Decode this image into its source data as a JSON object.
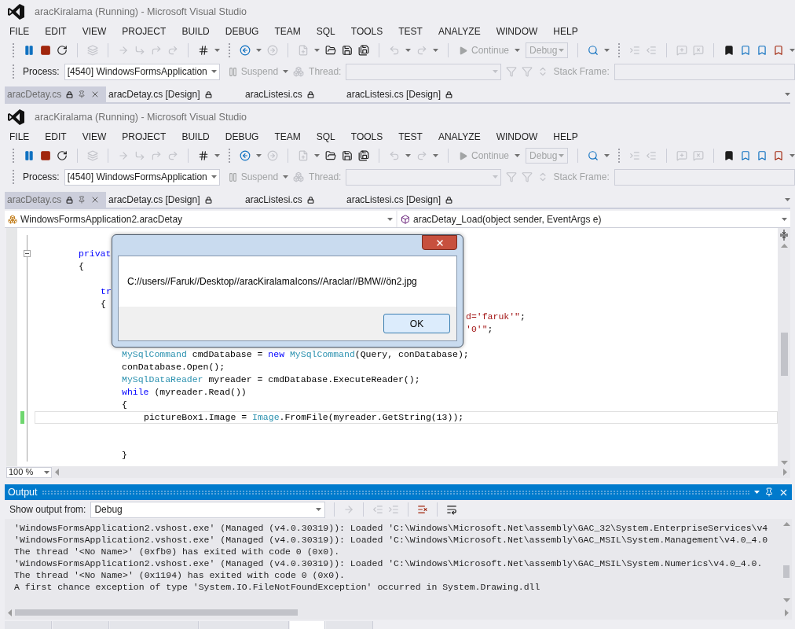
{
  "headers": [
    {
      "title": "aracKiralama (Running) - Microsoft Visual Studio",
      "menu": [
        "FILE",
        "EDIT",
        "VIEW",
        "PROJECT",
        "BUILD",
        "DEBUG",
        "TEAM",
        "SQL",
        "TOOLS",
        "TEST",
        "ANALYZE",
        "WINDOW",
        "HELP"
      ],
      "continue_button": {
        "label": "Continue",
        "disabled": true
      },
      "configuration": {
        "value": "Debug",
        "disabled": true
      },
      "process_label": "Process:",
      "process_value": "[4540] WindowsFormsApplication",
      "suspend_button": {
        "label": "Suspend",
        "disabled": true
      },
      "thread_label": {
        "label": "Thread:",
        "disabled": true
      },
      "stack_frame_label": {
        "label": "Stack Frame:",
        "disabled": true
      },
      "tabs": [
        {
          "label": "aracDetay.cs",
          "selected": true
        },
        {
          "label": "aracDetay.cs [Design]",
          "selected": false
        },
        {
          "label": "aracListesi.cs",
          "selected": false
        },
        {
          "label": "aracListesi.cs [Design]",
          "selected": false
        }
      ]
    },
    {
      "title": "aracKiralama (Running) - Microsoft Visual Studio",
      "menu": [
        "FILE",
        "EDIT",
        "VIEW",
        "PROJECT",
        "BUILD",
        "DEBUG",
        "TEAM",
        "SQL",
        "TOOLS",
        "TEST",
        "ANALYZE",
        "WINDOW",
        "HELP"
      ],
      "continue_button": {
        "label": "Continue",
        "disabled": true
      },
      "configuration": {
        "value": "Debug",
        "disabled": true
      },
      "process_label": "Process:",
      "process_value": "[4540] WindowsFormsApplication",
      "suspend_button": {
        "label": "Suspend",
        "disabled": true
      },
      "thread_label": {
        "label": "Thread:",
        "disabled": true
      },
      "stack_frame_label": {
        "label": "Stack Frame:",
        "disabled": true
      },
      "tabs": [
        {
          "label": "aracDetay.cs",
          "selected": true
        },
        {
          "label": "aracDetay.cs [Design]",
          "selected": false
        },
        {
          "label": "aracListesi.cs",
          "selected": false
        },
        {
          "label": "aracListesi.cs [Design]",
          "selected": false
        }
      ]
    }
  ],
  "navigation_bar": {
    "type_combo": "WindowsFormsApplication2.aracDetay",
    "member_combo": "aracDetay_Load(object sender, EventArgs e)"
  },
  "code_lines": [
    {
      "kind": "blank",
      "current": false
    },
    {
      "kind": "declaration",
      "current": false,
      "tokens": [
        {
          "kind": "keyword",
          "text": "privat"
        }
      ]
    },
    {
      "kind": "member",
      "current": false,
      "tokens": [
        {
          "kind": "plain",
          "text": "{"
        }
      ]
    },
    {
      "kind": "blank",
      "current": false
    },
    {
      "kind": "statement",
      "current": false,
      "tokens": [
        {
          "kind": "keyword",
          "text": "tr"
        }
      ]
    },
    {
      "kind": "statement",
      "current": false,
      "tokens": [
        {
          "kind": "plain",
          "text": "{"
        }
      ]
    },
    {
      "kind": "tail",
      "current": false,
      "tokens": [
        {
          "kind": "string",
          "text": "d='faruk'\""
        },
        {
          "kind": "plain",
          "text": ";"
        }
      ]
    },
    {
      "kind": "tail",
      "current": false,
      "tokens": [
        {
          "kind": "string",
          "text": "'0'\""
        },
        {
          "kind": "plain",
          "text": ";"
        }
      ]
    },
    {
      "kind": "blank",
      "current": false
    },
    {
      "kind": "try_statement",
      "current": false,
      "tokens": [
        {
          "kind": "type",
          "text": "MySqlCommand"
        },
        {
          "kind": "plain",
          "text": " cmdDatabase = "
        },
        {
          "kind": "keyword",
          "text": "new "
        },
        {
          "kind": "type",
          "text": "MySqlCommand"
        },
        {
          "kind": "plain",
          "text": "(Query, conDatabase);"
        }
      ]
    },
    {
      "kind": "try_statement",
      "current": false,
      "tokens": [
        {
          "kind": "plain",
          "text": "conDatabase.Open();"
        }
      ]
    },
    {
      "kind": "try_statement",
      "current": false,
      "tokens": [
        {
          "kind": "type",
          "text": "MySqlDataReader"
        },
        {
          "kind": "plain",
          "text": " myreader = cmdDatabase.ExecuteReader();"
        }
      ]
    },
    {
      "kind": "try_statement",
      "current": false,
      "tokens": [
        {
          "kind": "keyword",
          "text": "while"
        },
        {
          "kind": "plain",
          "text": " (myreader.Read())"
        }
      ]
    },
    {
      "kind": "try_statement",
      "current": false,
      "tokens": [
        {
          "kind": "plain",
          "text": "{"
        }
      ]
    },
    {
      "kind": "loop_statement",
      "current": true,
      "tokens": [
        {
          "kind": "plain",
          "text": "pictureBox1.Image = "
        },
        {
          "kind": "type",
          "text": "Image"
        },
        {
          "kind": "plain",
          "text": ".FromFile(myreader.GetString(13));"
        }
      ]
    },
    {
      "kind": "blank",
      "current": false
    },
    {
      "kind": "blank",
      "current": false
    },
    {
      "kind": "try_statement",
      "current": false,
      "tokens": [
        {
          "kind": "plain",
          "text": "}"
        }
      ]
    }
  ],
  "tool_window_tabs": [
    {
      "selected": false
    },
    {
      "selected": false
    },
    {
      "selected": false
    },
    {
      "selected": false
    },
    {
      "selected": true
    },
    {
      "selected": false
    }
  ],
  "zoom": "100 %",
  "message_box": {
    "message": "C://users//Faruk//Desktop//aracKiralamaIcons//Araclar//BMW//ön2.jpg",
    "button": "OK"
  },
  "output": {
    "title": "Output",
    "show_from_label": "Show output from:",
    "source": "Debug",
    "lines": [
      "'WindowsFormsApplication2.vshost.exe' (Managed (v4.0.30319)): Loaded 'C:\\Windows\\Microsoft.Net\\assembly\\GAC_32\\System.EnterpriseServices\\v4",
      "'WindowsFormsApplication2.vshost.exe' (Managed (v4.0.30319)): Loaded 'C:\\Windows\\Microsoft.Net\\assembly\\GAC_MSIL\\System.Management\\v4.0_4.0",
      "The thread '<No Name>' (0xfb0) has exited with code 0 (0x0).",
      "'WindowsFormsApplication2.vshost.exe' (Managed (v4.0.30319)): Loaded 'C:\\Windows\\Microsoft.Net\\assembly\\GAC_MSIL\\System.Numerics\\v4.0_4.0.",
      "The thread '<No Name>' (0x1194) has exited with code 0 (0x0).",
      "A first chance exception of type 'System.IO.FileNotFoundException' occurred in System.Drawing.dll"
    ]
  }
}
